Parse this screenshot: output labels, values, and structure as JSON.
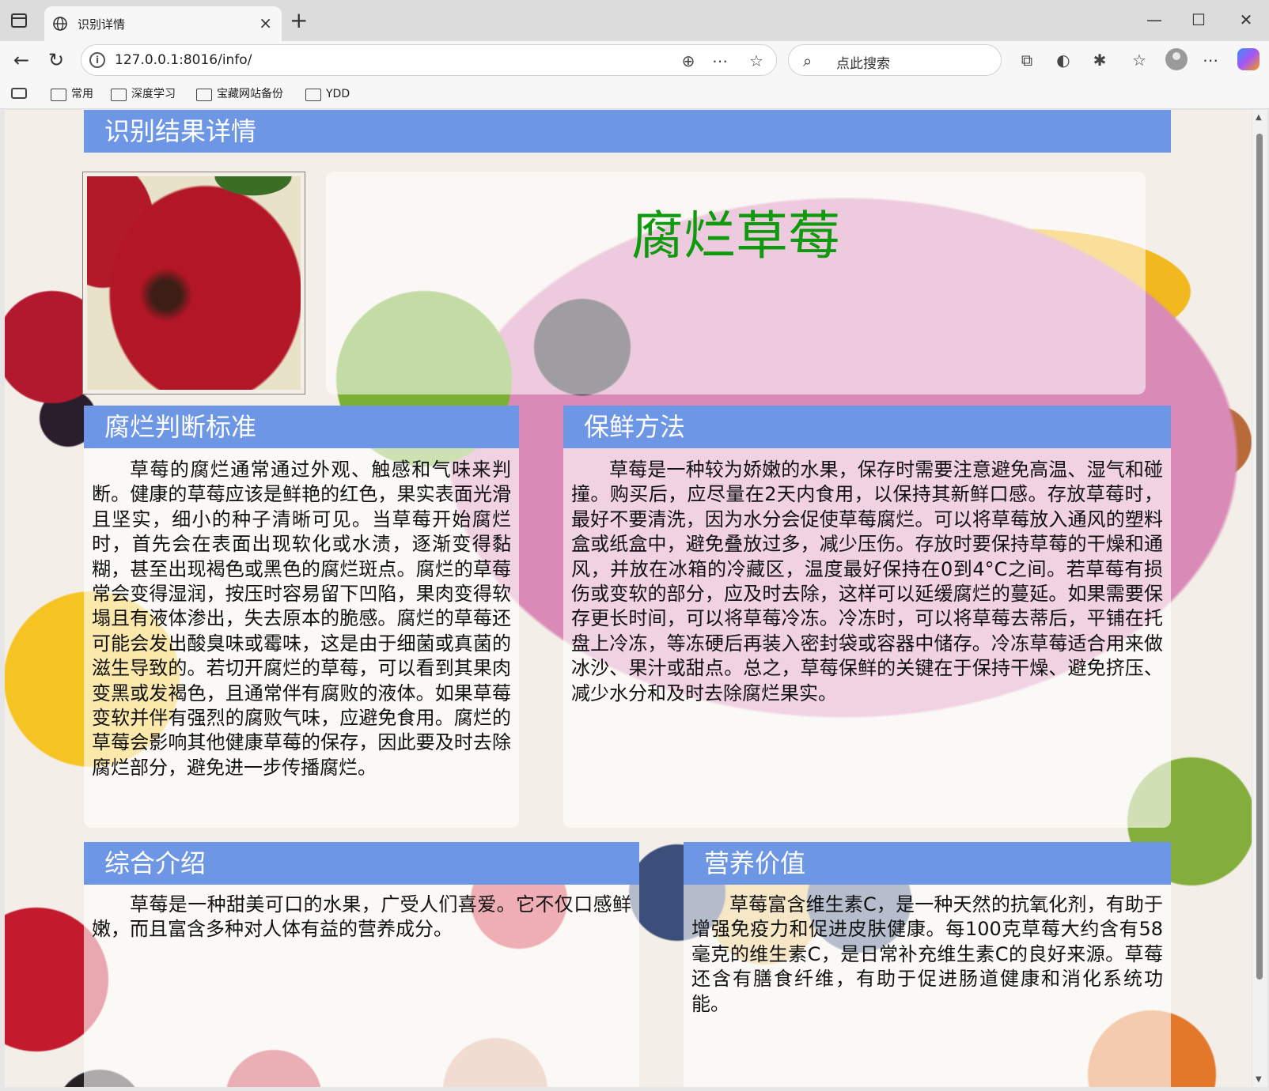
{
  "browser": {
    "tab_title": "识别详情",
    "tab_close": "×",
    "new_tab": "+",
    "url": "127.0.0.1:8016/info/",
    "search_placeholder": "点此搜索",
    "window": {
      "minimize": "—",
      "maximize": "☐",
      "close": "✕"
    },
    "bookmarks": [
      "常用",
      "深度学习",
      "宝藏网站备份",
      "YDD"
    ]
  },
  "page": {
    "header": "识别结果详情",
    "result_title": "腐烂草莓",
    "sections": {
      "rot": {
        "title": "腐烂判断标准",
        "text": "草莓的腐烂通常通过外观、触感和气味来判断。健康的草莓应该是鲜艳的红色，果实表面光滑且坚实，细小的种子清晰可见。当草莓开始腐烂时，首先会在表面出现软化或水渍，逐渐变得黏糊，甚至出现褐色或黑色的腐烂斑点。腐烂的草莓常会变得湿润，按压时容易留下凹陷，果肉变得软塌且有液体渗出，失去原本的脆感。腐烂的草莓还可能会发出酸臭味或霉味，这是由于细菌或真菌的滋生导致的。若切开腐烂的草莓，可以看到其果肉变黑或发褐色，且通常伴有腐败的液体。如果草莓变软并伴有强烈的腐败气味，应避免食用。腐烂的草莓会影响其他健康草莓的保存，因此要及时去除腐烂部分，避免进一步传播腐烂。"
      },
      "storage": {
        "title": "保鲜方法",
        "text": "草莓是一种较为娇嫩的水果，保存时需要注意避免高温、湿气和碰撞。购买后，应尽量在2天内食用，以保持其新鲜口感。存放草莓时，最好不要清洗，因为水分会促使草莓腐烂。可以将草莓放入通风的塑料盒或纸盒中，避免叠放过多，减少压伤。存放时要保持草莓的干燥和通风，并放在冰箱的冷藏区，温度最好保持在0到4°C之间。若草莓有损伤或变软的部分，应及时去除，这样可以延缓腐烂的蔓延。如果需要保存更长时间，可以将草莓冷冻。冷冻时，可以将草莓去蒂后，平铺在托盘上冷冻，等冻硬后再装入密封袋或容器中储存。冷冻草莓适合用来做冰沙、果汁或甜点。总之，草莓保鲜的关键在于保持干燥、避免挤压、减少水分和及时去除腐烂果实。"
      },
      "intro": {
        "title": "综合介绍",
        "text": "草莓是一种甜美可口的水果，广受人们喜爱。它不仅口感鲜嫩，而且富含多种对人体有益的营养成分。"
      },
      "nutrition": {
        "title": "营养价值",
        "text": "草莓富含维生素C，是一种天然的抗氧化剂，有助于增强免疫力和促进皮肤健康。每100克草莓大约含有58毫克的维生素C，是日常补充维生素C的良好来源。草莓还含有膳食纤维，有助于促进肠道健康和消化系统功能。"
      }
    }
  }
}
